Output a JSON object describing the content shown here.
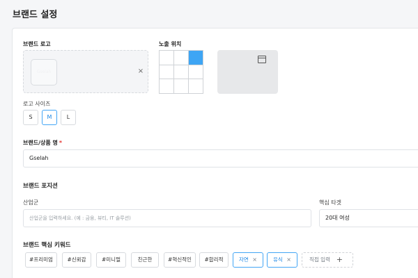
{
  "page": {
    "title": "브랜드 설정"
  },
  "logo": {
    "label": "브랜드 로고",
    "thumbnail_text": "Gselah",
    "remove": "×",
    "position_label": "노출 위치",
    "position_selected": "top-right",
    "size_label": "로고 사이즈",
    "sizes": [
      "S",
      "M",
      "L"
    ],
    "size_selected": "M"
  },
  "brand_name": {
    "label": "브랜드/상품 명",
    "required_mark": "*",
    "value": "Gselah"
  },
  "brand_position": {
    "title": "브랜드 포지션",
    "industry_label": "산업군",
    "industry_placeholder": "산업군을 입력하세요. (예 : 금융, 뷰티, IT 솔루션)",
    "target_label": "핵심 타겟",
    "target_value": "20대 여성"
  },
  "keywords": {
    "title": "브랜드 핵심 키워드",
    "tags": [
      "#프리미엄",
      "#신뢰감",
      "#미니멀",
      "친근한",
      "#혁신적인",
      "#합리적"
    ],
    "selected": [
      "자연",
      "유식"
    ],
    "remove": "×",
    "input_placeholder": "직접 입력",
    "add_icon": "+"
  },
  "colors": {
    "accent": "#3ea5f4",
    "required": "#e53935"
  }
}
